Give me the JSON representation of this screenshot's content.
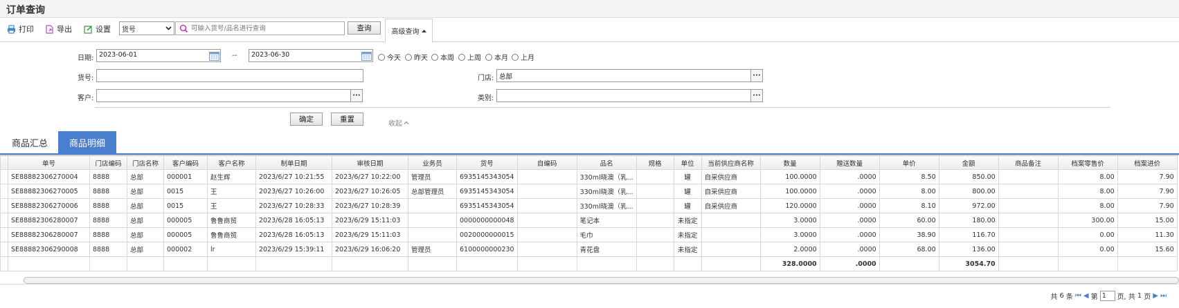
{
  "page": {
    "title": "订单查询"
  },
  "toolbar": {
    "print": "打印",
    "export": "导出",
    "settings": "设置",
    "field_select": "货号",
    "search_placeholder": "可输入货号/品名进行查询",
    "query": "查询",
    "advanced": "高级查询"
  },
  "form": {
    "date_label": "日期:",
    "date_from": "2023-06-01",
    "date_sep": "--",
    "date_to": "2023-06-30",
    "quick_ranges": [
      "今天",
      "昨天",
      "本周",
      "上周",
      "本月",
      "上月"
    ],
    "sku_label": "货号:",
    "sku_value": "",
    "store_label": "门店:",
    "store_value": "总部",
    "customer_label": "客户:",
    "customer_value": "",
    "category_label": "类别:",
    "category_value": "",
    "confirm": "确定",
    "reset": "重置",
    "collapse": "收起"
  },
  "tabs": [
    "商品汇总",
    "商品明细"
  ],
  "table": {
    "columns": [
      "单号",
      "门店编码",
      "门店名称",
      "客户编码",
      "客户名称",
      "制单日期",
      "审核日期",
      "业务员",
      "货号",
      "自编码",
      "品名",
      "规格",
      "单位",
      "当前供应商名称",
      "数量",
      "赠送数量",
      "单价",
      "金额",
      "商品备注",
      "档案零售价",
      "档案进价"
    ],
    "rows": [
      [
        "SE88882306270004",
        "8888",
        "总部",
        "000001",
        "赵生辉",
        "2023/6/27 10:21:55",
        "2023/6/27 10:22:00",
        "管理员",
        "6935145343054",
        "",
        "330ml晓澳（乳...",
        "",
        "罐",
        "自采供应商",
        "100.0000",
        ".0000",
        "8.50",
        "850.00",
        "",
        "8.00",
        "7.90"
      ],
      [
        "SE88882306270005",
        "8888",
        "总部",
        "0015",
        "王",
        "2023/6/27 10:26:00",
        "2023/6/27 10:26:05",
        "总部管理员",
        "6935145343054",
        "",
        "330ml晓澳（乳...",
        "",
        "罐",
        "自采供应商",
        "100.0000",
        ".0000",
        "8.00",
        "800.00",
        "",
        "8.00",
        "7.90"
      ],
      [
        "SE88882306270006",
        "8888",
        "总部",
        "0015",
        "王",
        "2023/6/27 10:28:33",
        "2023/6/27 10:28:39",
        "",
        "6935145343054",
        "",
        "330ml晓澳（乳...",
        "",
        "罐",
        "自采供应商",
        "120.0000",
        ".0000",
        "8.10",
        "972.00",
        "",
        "8.00",
        "7.90"
      ],
      [
        "SE88882306280007",
        "8888",
        "总部",
        "000005",
        "鲁鲁商贸",
        "2023/6/28 16:05:13",
        "2023/6/29 15:11:03",
        "",
        "0000000000048",
        "",
        "笔记本",
        "",
        "未指定",
        "",
        "3.0000",
        ".0000",
        "60.00",
        "180.00",
        "",
        "300.00",
        "15.00"
      ],
      [
        "SE88882306280007",
        "8888",
        "总部",
        "000005",
        "鲁鲁商贸",
        "2023/6/28 16:05:13",
        "2023/6/29 15:11:03",
        "",
        "0020000000015",
        "",
        "毛巾",
        "",
        "未指定",
        "",
        "3.0000",
        ".0000",
        "38.90",
        "116.70",
        "",
        "0.00",
        "11.30"
      ],
      [
        "SE88882306290008",
        "8888",
        "总部",
        "000002",
        "lr",
        "2023/6/29 15:39:11",
        "2023/6/29 16:06:20",
        "管理员",
        "6100000000230",
        "",
        "青花盘",
        "",
        "未指定",
        "",
        "2.0000",
        ".0000",
        "68.00",
        "136.00",
        "",
        "0.00",
        "15.60"
      ]
    ],
    "totals": {
      "qty": "328.0000",
      "gift_qty": ".0000",
      "amount": "3054.70"
    }
  },
  "pager": {
    "total_prefix": "共",
    "total": "6",
    "total_suffix": "条",
    "page_prefix": "第",
    "current": "1",
    "page_mid": "页, 共",
    "pages": "1",
    "page_suffix": "页"
  }
}
